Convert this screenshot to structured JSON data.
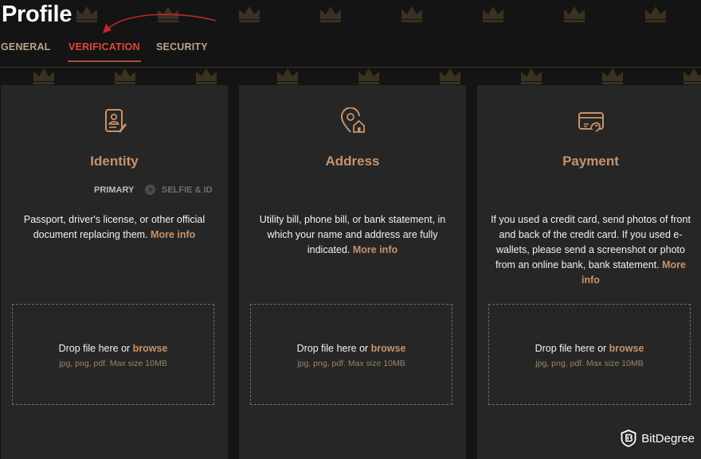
{
  "page": {
    "title": "Profile"
  },
  "tabs": {
    "general": "GENERAL",
    "verification": "VERIFICATION",
    "security": "SECURITY",
    "active": "verification"
  },
  "cards": {
    "identity": {
      "icon": "id-card-icon",
      "title": "Identity",
      "subtabs": {
        "primary": "PRIMARY",
        "secondary": "SELFIE & ID"
      },
      "description": "Passport, driver's license, or other official document replacing them.",
      "more": "More info",
      "drop_prefix": "Drop file here or",
      "browse": "browse",
      "hint": "jpg, png, pdf. Max size 10MB"
    },
    "address": {
      "icon": "location-home-icon",
      "title": "Address",
      "description": "Utility bill, phone bill, or bank statement, in which your name and address are fully indicated.",
      "more": "More info",
      "drop_prefix": "Drop file here or",
      "browse": "browse",
      "hint": "jpg, png, pdf. Max size 10MB"
    },
    "payment": {
      "icon": "payment-card-icon",
      "title": "Payment",
      "description": "If you used a credit card, send photos of front and back of the credit card. If you used e-wallets, please send a screenshot or photo from an online bank, bank statement.",
      "more": "More info",
      "drop_prefix": "Drop file here or",
      "browse": "browse",
      "hint": "jpg, png, pdf. Max size 10MB"
    }
  },
  "watermark": {
    "text": "BitDegree",
    "icon": "bitdegree-logo-icon"
  },
  "colors": {
    "accent": "#c9926a",
    "active_tab": "#e0463a",
    "background": "#141414",
    "card": "#262626"
  }
}
